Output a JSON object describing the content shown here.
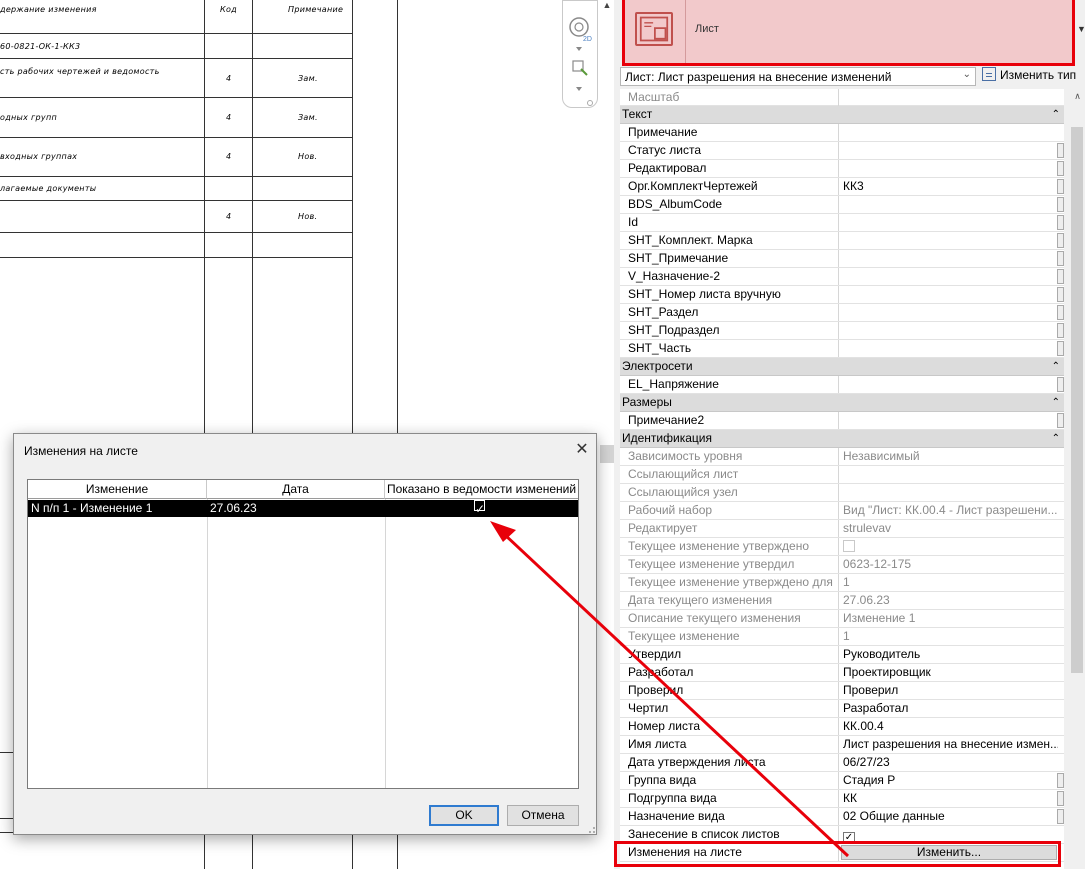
{
  "sheet": {
    "headers": {
      "change": "держание изменения",
      "code": "Код",
      "note": "Примечание"
    },
    "rows": [
      {
        "text": "60-0821-ОК-1-КК3",
        "code": "",
        "note": ""
      },
      {
        "text": "сть рабочих чертежей и ведомость",
        "code": "4",
        "note": "Зам."
      },
      {
        "text": "одных групп",
        "code": "4",
        "note": "Зам."
      },
      {
        "text": "входных группах",
        "code": "4",
        "note": "Нов."
      },
      {
        "text": "лагаемые документы",
        "code": "",
        "note": ""
      },
      {
        "text": "",
        "code": "4",
        "note": "Нов."
      }
    ]
  },
  "type_selector": {
    "name": "Лист",
    "instance_label": "Лист: Лист разрешения на внесение изменений",
    "edit_type_label": "Изменить тип",
    "partial_row": "Масштаб"
  },
  "groups": {
    "text": "Текст",
    "electrical": "Электросети",
    "dimensions": "Размеры",
    "identity": "Идентификация"
  },
  "text_params": [
    {
      "label": "Примечание",
      "value": ""
    },
    {
      "label": "Статус листа",
      "value": ""
    },
    {
      "label": "Редактировал",
      "value": ""
    },
    {
      "label": "Орг.КомплектЧертежей",
      "value": "КК3"
    },
    {
      "label": "BDS_AlbumCode",
      "value": ""
    },
    {
      "label": "Id",
      "value": ""
    },
    {
      "label": "SHT_Комплект. Марка",
      "value": ""
    },
    {
      "label": "SHT_Примечание",
      "value": ""
    },
    {
      "label": "V_Назначение-2",
      "value": ""
    },
    {
      "label": "SHT_Номер листа вручную",
      "value": ""
    },
    {
      "label": "SHT_Раздел",
      "value": ""
    },
    {
      "label": "SHT_Подраздел",
      "value": ""
    },
    {
      "label": "SHT_Часть",
      "value": ""
    }
  ],
  "electrical_params": [
    {
      "label": "EL_Напряжение",
      "value": ""
    }
  ],
  "dimension_params": [
    {
      "label": "Примечание2",
      "value": ""
    }
  ],
  "identity_params": [
    {
      "label": "Зависимость уровня",
      "value": "Независимый",
      "readonly": true
    },
    {
      "label": "Ссылающийся лист",
      "value": "",
      "readonly": true
    },
    {
      "label": "Ссылающийся узел",
      "value": "",
      "readonly": true
    },
    {
      "label": "Рабочий набор",
      "value": "Вид \"Лист: КК.00.4 - Лист разрешени...",
      "readonly": true
    },
    {
      "label": "Редактирует",
      "value": "strulevav",
      "readonly": true
    },
    {
      "label": "Текущее изменение утверждено",
      "value": "",
      "readonly": true,
      "checkbox": true
    },
    {
      "label": "Текущее изменение утвердил",
      "value": "0623-12-175",
      "readonly": true
    },
    {
      "label": "Текущее изменение утверждено для",
      "value": "1",
      "readonly": true
    },
    {
      "label": "Дата текущего изменения",
      "value": "27.06.23",
      "readonly": true
    },
    {
      "label": "Описание текущего изменения",
      "value": "Изменение 1",
      "readonly": true
    },
    {
      "label": "Текущее изменение",
      "value": "1",
      "readonly": true
    },
    {
      "label": "Утвердил",
      "value": "Руководитель"
    },
    {
      "label": "Разработал",
      "value": "Проектировщик"
    },
    {
      "label": "Проверил",
      "value": "Проверил"
    },
    {
      "label": "Чертил",
      "value": "Разработал"
    },
    {
      "label": "Номер листа",
      "value": "КК.00.4"
    },
    {
      "label": "Имя листа",
      "value": "Лист разрешения на внесение измен..."
    },
    {
      "label": "Дата утверждения листа",
      "value": "06/27/23"
    },
    {
      "label": "Группа вида",
      "value": "Стадия Р"
    },
    {
      "label": "Подгруппа вида",
      "value": "КК"
    },
    {
      "label": "Назначение вида",
      "value": "02 Общие данные"
    },
    {
      "label": "Занесение в список листов",
      "value": "",
      "checkbox": true,
      "checked": true
    }
  ],
  "revisions_row": {
    "label": "Изменения на листе",
    "button": "Изменить..."
  },
  "dialog": {
    "title": "Изменения на листе",
    "columns": [
      "Изменение",
      "Дата",
      "Показано в ведомости изменений"
    ],
    "rows": [
      {
        "change": "N п/п 1 - Изменение 1",
        "date": "27.06.23",
        "shown": true
      }
    ],
    "ok": "OK",
    "cancel": "Отмена"
  },
  "colors": {
    "highlight": "#e8000a",
    "header_fill": "#f2c9cb",
    "selection": "#000000",
    "ok_border": "#2f7bd0"
  },
  "icons": [
    "sheet-type-icon",
    "edit-type-icon",
    "chevron-down-icon",
    "collapse-icon",
    "close-icon",
    "checkbox-checked-icon"
  ]
}
